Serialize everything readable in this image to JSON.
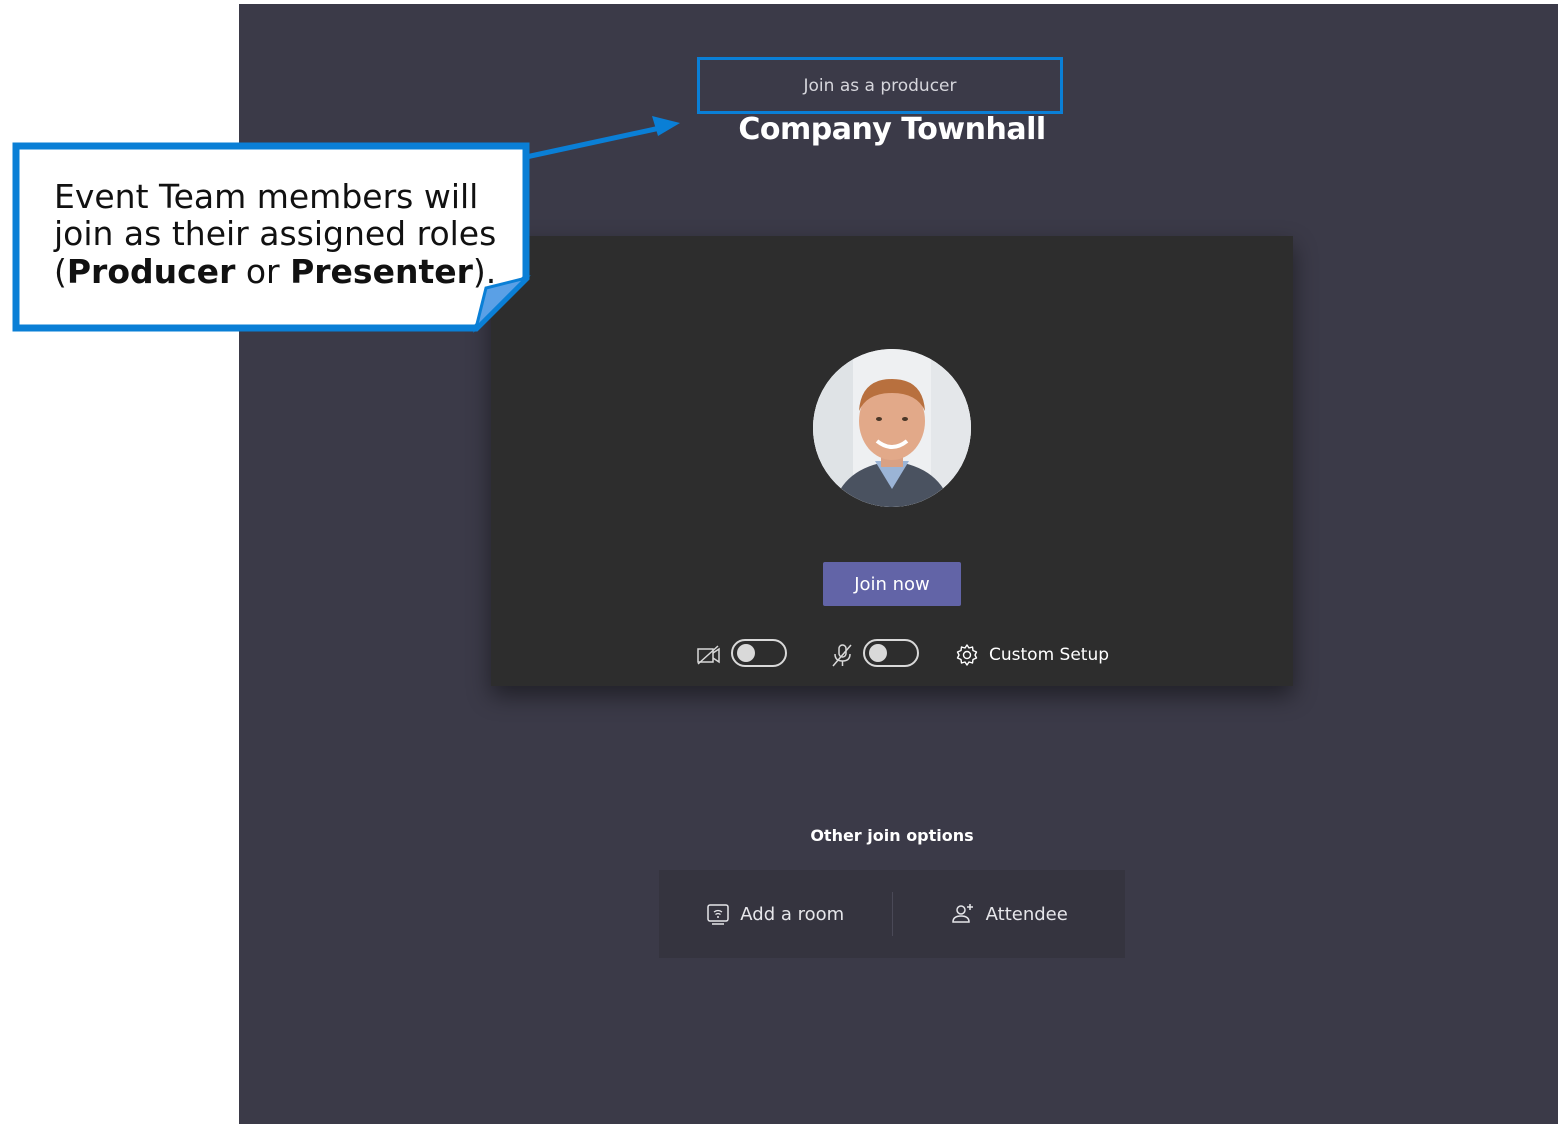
{
  "meeting": {
    "role_label": "Join as a producer",
    "title": "Company Townhall"
  },
  "preview": {
    "avatar_alt": "Participant profile photo",
    "join_button": "Join now",
    "camera_toggle": "off",
    "mic_toggle": "off",
    "custom_setup_label": "Custom Setup"
  },
  "other_options": {
    "heading": "Other join options",
    "add_room": "Add a room",
    "attendee": "Attendee"
  },
  "callout": {
    "line1": "Event Team members will join as their assigned roles (",
    "role_a": "Producer",
    "joiner": " or ",
    "role_b": "Presenter",
    "end": ")."
  },
  "colors": {
    "app_bg": "#3b3a48",
    "card_bg": "#2d2d2d",
    "accent": "#6264a7",
    "callout_border": "#0a7fd6"
  },
  "icons": [
    "camera-off-icon",
    "mic-off-icon",
    "gear-icon",
    "room-icon",
    "attendee-icon"
  ]
}
